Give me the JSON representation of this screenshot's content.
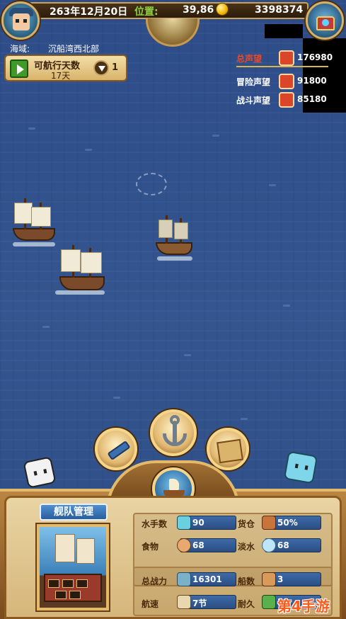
{
  "top_bar": {
    "date": "263年12月20日",
    "location_label": "位置:",
    "location_value": "39,86",
    "gold": "3398374"
  },
  "area": {
    "label": "海域:",
    "name": "沉船湾西北部"
  },
  "voyage": {
    "label": "可航行天数",
    "days": "17天",
    "count": "1"
  },
  "reputation": [
    {
      "label": "总声望",
      "value": "176980",
      "color": "#e84a2a"
    },
    {
      "label": "冒险声望",
      "value": "91800",
      "color": "#ffffff"
    },
    {
      "label": "战斗声望",
      "value": "85180",
      "color": "#ffffff"
    }
  ],
  "fleet": {
    "title": "舰队管理",
    "stats": [
      {
        "label": "水手数",
        "value": "90"
      },
      {
        "label": "货仓",
        "value": "50%"
      },
      {
        "label": "食物",
        "value": "68"
      },
      {
        "label": "淡水",
        "value": "68"
      },
      {
        "label": "总战力",
        "value": "16301"
      },
      {
        "label": "船数",
        "value": "3"
      },
      {
        "label": "航速",
        "value": "7节"
      },
      {
        "label": "耐久",
        "value": "23"
      }
    ]
  },
  "watermark": "第4手游",
  "colors": {
    "ocean": "#2f4f8a",
    "frame": "#c9a25b",
    "accent_green": "#8bd040",
    "accent_red": "#e84a2a"
  }
}
